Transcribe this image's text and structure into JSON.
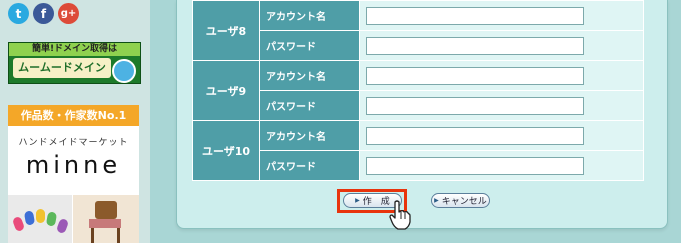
{
  "social": {
    "twitter": "t",
    "facebook": "f",
    "googleplus": "g+"
  },
  "ads": {
    "muumuu": {
      "top_text": "簡単!ドメイン取得は",
      "brand_text": "ムームードメイン"
    },
    "minne": {
      "banner_text": "作品数・作家数No.1",
      "subtitle": "ハンドメイドマーケット",
      "logo": "minne"
    }
  },
  "users": [
    {
      "label": "ユーザ8",
      "account_label": "アカウント名",
      "password_label": "パスワード",
      "account_value": "",
      "password_value": ""
    },
    {
      "label": "ユーザ9",
      "account_label": "アカウント名",
      "password_label": "パスワード",
      "account_value": "",
      "password_value": ""
    },
    {
      "label": "ユーザ10",
      "account_label": "アカウント名",
      "password_label": "パスワード",
      "account_value": "",
      "password_value": ""
    }
  ],
  "buttons": {
    "create": "作　成",
    "cancel": "キャンセル"
  },
  "colors": {
    "highlight": "#e8340d",
    "label_bg": "#4f9ea7",
    "panel_bg": "#cdeeed"
  }
}
